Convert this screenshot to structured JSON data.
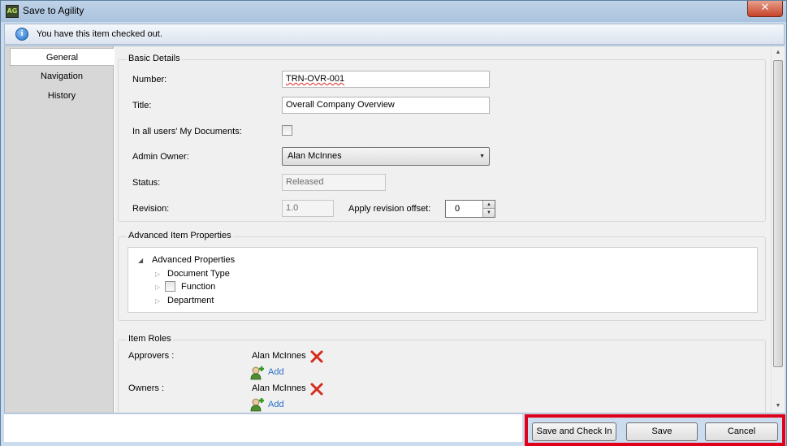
{
  "window": {
    "title": "Save to Agility",
    "icon_label": "AG",
    "close_label": "✕"
  },
  "info": {
    "icon_name": "info-icon",
    "message": "You have this item checked out."
  },
  "nav": {
    "items": [
      {
        "label": "General",
        "active": true
      },
      {
        "label": "Navigation",
        "active": false
      },
      {
        "label": "History",
        "active": false
      }
    ]
  },
  "basic_details": {
    "group_label": "Basic Details",
    "number_label": "Number:",
    "number_value": "TRN-OVR-001",
    "title_label": "Title:",
    "title_value": "Overall Company Overview",
    "my_docs_label": "In all users' My Documents:",
    "my_docs_checked": false,
    "admin_owner_label": "Admin Owner:",
    "admin_owner_value": "Alan McInnes",
    "status_label": "Status:",
    "status_value": "Released",
    "revision_label": "Revision:",
    "revision_value": "1.0",
    "revision_offset_label": "Apply revision offset:",
    "revision_offset_value": "0"
  },
  "advanced": {
    "group_label": "Advanced Item Properties",
    "root_label": "Advanced Properties",
    "children": [
      {
        "label": "Document Type",
        "has_checkbox": false
      },
      {
        "label": "Function",
        "has_checkbox": true
      },
      {
        "label": "Department",
        "has_checkbox": false
      }
    ]
  },
  "roles": {
    "group_label": "Item Roles",
    "approvers_label": "Approvers :",
    "approver_name": "Alan McInnes",
    "owners_label": "Owners :",
    "owner_name": "Alan McInnes",
    "add_label": "Add"
  },
  "buttons": {
    "save_check_in": "Save and Check In",
    "save": "Save",
    "cancel": "Cancel"
  },
  "colors": {
    "highlight": "#e0001a",
    "link": "#2a70c8",
    "remove_icon": "#d42c1c"
  }
}
